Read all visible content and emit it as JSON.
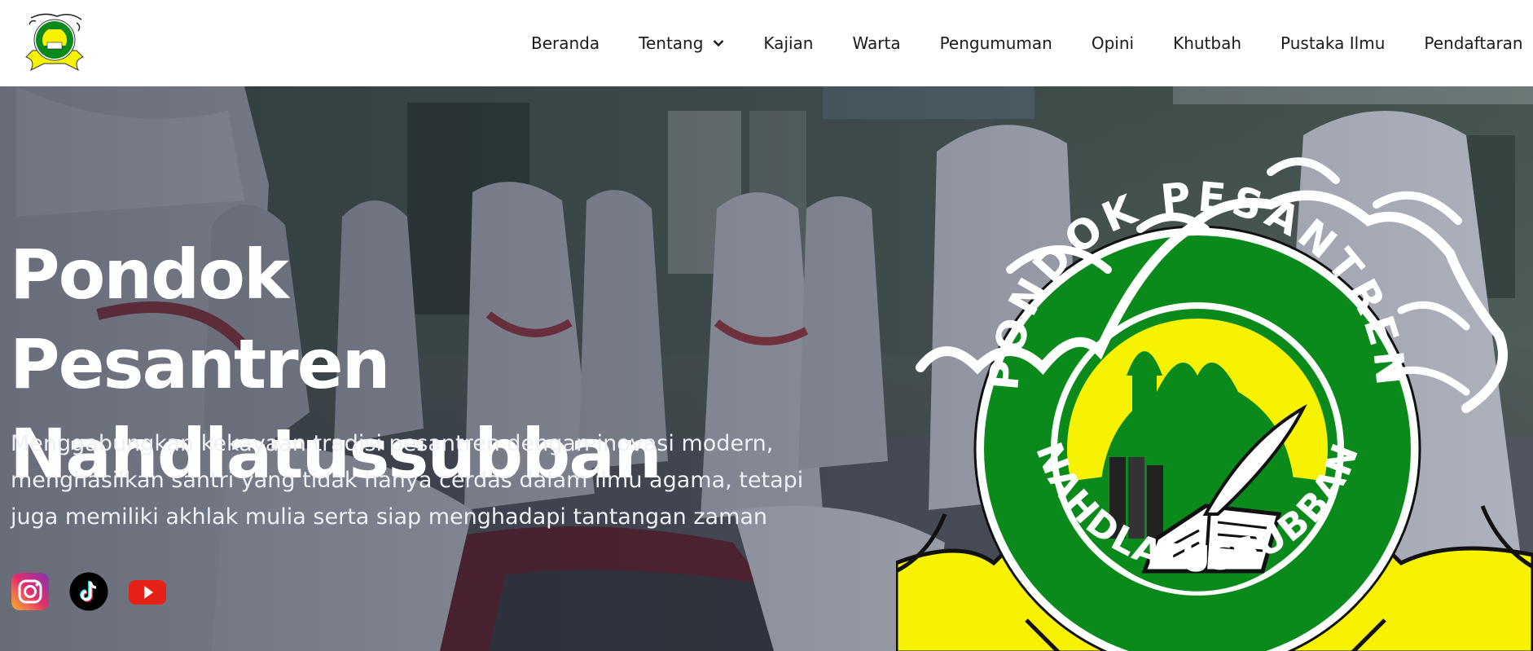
{
  "brand": {
    "name_ring": "PONDOK PESANTREN",
    "motto": "NAHDLATUSSUBBAN",
    "colors": {
      "green": "#0b8a1c",
      "yellow": "#f6f200",
      "dark_green": "#0a6d15"
    }
  },
  "nav": {
    "items": [
      {
        "label": "Beranda"
      },
      {
        "label": "Tentang",
        "dropdown": true,
        "icon": "chevron-down-icon"
      },
      {
        "label": "Kajian"
      },
      {
        "label": "Warta"
      },
      {
        "label": "Pengumuman"
      },
      {
        "label": "Opini"
      },
      {
        "label": "Khutbah"
      },
      {
        "label": "Pustaka Ilmu"
      },
      {
        "label": "Pendaftaran"
      }
    ]
  },
  "hero": {
    "title_line1": "Pondok Pesantren",
    "title_line2": "Nahdlatussubban",
    "description_lines": [
      "Menggabungkan kekayaan tradisi pesantren dengan inovasi modern,",
      "menghasilkan santri yang tidak hanya cerdas dalam ilmu agama, tetapi",
      "juga memiliki akhlak mulia serta siap menghadapi tantangan zaman"
    ],
    "social": [
      {
        "icon": "instagram-icon",
        "color": "#e1306c"
      },
      {
        "icon": "tiktok-icon",
        "color": "#000000"
      },
      {
        "icon": "youtube-icon",
        "color": "#e62117"
      }
    ]
  }
}
